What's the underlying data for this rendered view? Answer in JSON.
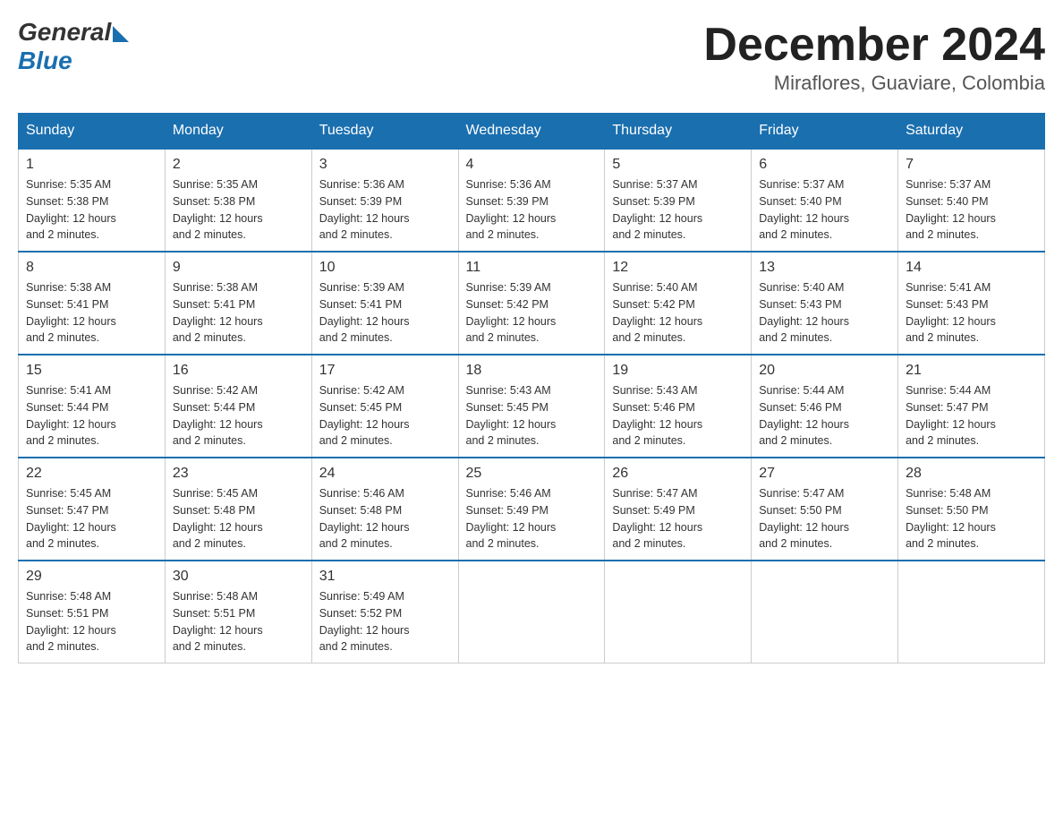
{
  "logo": {
    "general": "General",
    "blue": "Blue"
  },
  "title": "December 2024",
  "location": "Miraflores, Guaviare, Colombia",
  "days_of_week": [
    "Sunday",
    "Monday",
    "Tuesday",
    "Wednesday",
    "Thursday",
    "Friday",
    "Saturday"
  ],
  "weeks": [
    [
      {
        "day": "1",
        "sunrise": "5:35 AM",
        "sunset": "5:38 PM",
        "daylight": "12 hours and 2 minutes."
      },
      {
        "day": "2",
        "sunrise": "5:35 AM",
        "sunset": "5:38 PM",
        "daylight": "12 hours and 2 minutes."
      },
      {
        "day": "3",
        "sunrise": "5:36 AM",
        "sunset": "5:39 PM",
        "daylight": "12 hours and 2 minutes."
      },
      {
        "day": "4",
        "sunrise": "5:36 AM",
        "sunset": "5:39 PM",
        "daylight": "12 hours and 2 minutes."
      },
      {
        "day": "5",
        "sunrise": "5:37 AM",
        "sunset": "5:39 PM",
        "daylight": "12 hours and 2 minutes."
      },
      {
        "day": "6",
        "sunrise": "5:37 AM",
        "sunset": "5:40 PM",
        "daylight": "12 hours and 2 minutes."
      },
      {
        "day": "7",
        "sunrise": "5:37 AM",
        "sunset": "5:40 PM",
        "daylight": "12 hours and 2 minutes."
      }
    ],
    [
      {
        "day": "8",
        "sunrise": "5:38 AM",
        "sunset": "5:41 PM",
        "daylight": "12 hours and 2 minutes."
      },
      {
        "day": "9",
        "sunrise": "5:38 AM",
        "sunset": "5:41 PM",
        "daylight": "12 hours and 2 minutes."
      },
      {
        "day": "10",
        "sunrise": "5:39 AM",
        "sunset": "5:41 PM",
        "daylight": "12 hours and 2 minutes."
      },
      {
        "day": "11",
        "sunrise": "5:39 AM",
        "sunset": "5:42 PM",
        "daylight": "12 hours and 2 minutes."
      },
      {
        "day": "12",
        "sunrise": "5:40 AM",
        "sunset": "5:42 PM",
        "daylight": "12 hours and 2 minutes."
      },
      {
        "day": "13",
        "sunrise": "5:40 AM",
        "sunset": "5:43 PM",
        "daylight": "12 hours and 2 minutes."
      },
      {
        "day": "14",
        "sunrise": "5:41 AM",
        "sunset": "5:43 PM",
        "daylight": "12 hours and 2 minutes."
      }
    ],
    [
      {
        "day": "15",
        "sunrise": "5:41 AM",
        "sunset": "5:44 PM",
        "daylight": "12 hours and 2 minutes."
      },
      {
        "day": "16",
        "sunrise": "5:42 AM",
        "sunset": "5:44 PM",
        "daylight": "12 hours and 2 minutes."
      },
      {
        "day": "17",
        "sunrise": "5:42 AM",
        "sunset": "5:45 PM",
        "daylight": "12 hours and 2 minutes."
      },
      {
        "day": "18",
        "sunrise": "5:43 AM",
        "sunset": "5:45 PM",
        "daylight": "12 hours and 2 minutes."
      },
      {
        "day": "19",
        "sunrise": "5:43 AM",
        "sunset": "5:46 PM",
        "daylight": "12 hours and 2 minutes."
      },
      {
        "day": "20",
        "sunrise": "5:44 AM",
        "sunset": "5:46 PM",
        "daylight": "12 hours and 2 minutes."
      },
      {
        "day": "21",
        "sunrise": "5:44 AM",
        "sunset": "5:47 PM",
        "daylight": "12 hours and 2 minutes."
      }
    ],
    [
      {
        "day": "22",
        "sunrise": "5:45 AM",
        "sunset": "5:47 PM",
        "daylight": "12 hours and 2 minutes."
      },
      {
        "day": "23",
        "sunrise": "5:45 AM",
        "sunset": "5:48 PM",
        "daylight": "12 hours and 2 minutes."
      },
      {
        "day": "24",
        "sunrise": "5:46 AM",
        "sunset": "5:48 PM",
        "daylight": "12 hours and 2 minutes."
      },
      {
        "day": "25",
        "sunrise": "5:46 AM",
        "sunset": "5:49 PM",
        "daylight": "12 hours and 2 minutes."
      },
      {
        "day": "26",
        "sunrise": "5:47 AM",
        "sunset": "5:49 PM",
        "daylight": "12 hours and 2 minutes."
      },
      {
        "day": "27",
        "sunrise": "5:47 AM",
        "sunset": "5:50 PM",
        "daylight": "12 hours and 2 minutes."
      },
      {
        "day": "28",
        "sunrise": "5:48 AM",
        "sunset": "5:50 PM",
        "daylight": "12 hours and 2 minutes."
      }
    ],
    [
      {
        "day": "29",
        "sunrise": "5:48 AM",
        "sunset": "5:51 PM",
        "daylight": "12 hours and 2 minutes."
      },
      {
        "day": "30",
        "sunrise": "5:48 AM",
        "sunset": "5:51 PM",
        "daylight": "12 hours and 2 minutes."
      },
      {
        "day": "31",
        "sunrise": "5:49 AM",
        "sunset": "5:52 PM",
        "daylight": "12 hours and 2 minutes."
      },
      null,
      null,
      null,
      null
    ]
  ],
  "labels": {
    "sunrise": "Sunrise:",
    "sunset": "Sunset:",
    "daylight": "Daylight:"
  }
}
